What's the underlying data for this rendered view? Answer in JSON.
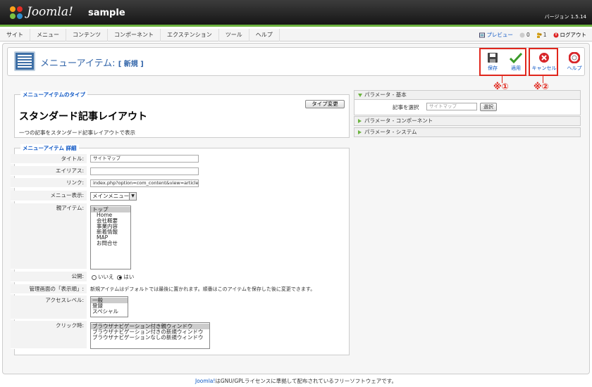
{
  "header": {
    "logo_text": "Joomla!",
    "site_name": "sample",
    "version": "バージョン 1.5.14"
  },
  "menubar": {
    "items": [
      "サイト",
      "メニュー",
      "コンテンツ",
      "コンポーネント",
      "エクステンション",
      "ツール",
      "ヘルプ"
    ],
    "preview": "プレビュー",
    "messages_count": "0",
    "users_count": "1",
    "logout": "ログアウト"
  },
  "toolbar": {
    "title": "メニューアイテム:",
    "title_sub": "[ 新規 ]",
    "save": "保存",
    "apply": "適用",
    "cancel": "キャンセル",
    "help": "ヘルプ"
  },
  "annotations": {
    "one": "※①",
    "two": "※②"
  },
  "menu_type": {
    "legend": "メニューアイテムのタイプ",
    "name": "スタンダード記事レイアウト",
    "description": "一つの記事をスタンダード記事レイアウトで表示",
    "change_button": "タイプ変更"
  },
  "details": {
    "legend": "メニューアイテム 詳細",
    "title_label": "タイトル:",
    "title_value": "サイトマップ",
    "alias_label": "エイリアス:",
    "alias_value": "",
    "link_label": "リンク:",
    "link_value": "index.php?option=com_content&view=article",
    "menu_label": "メニュー表示:",
    "menu_value": "メインメニュー",
    "parent_label": "親アイテム:",
    "parent_items": [
      "トップ",
      "Home",
      "会社概要",
      "事業内容",
      "新着情報",
      "MAP",
      "お問合せ"
    ],
    "published_label": "公開:",
    "published_no": "いいえ",
    "published_yes": "はい",
    "order_label": "管理画面の「表示順」:",
    "order_text": "新規アイテムはデフォルトでは最後に置かれます。順番はこのアイテムを保存した後に変更できます。",
    "access_label": "アクセスレベル:",
    "access_items": [
      "一般",
      "登録",
      "スペシャル"
    ],
    "click_label": "クリック時:",
    "click_items": [
      "ブラウザナビゲーション付き親ウィンドウ",
      "ブラウザナビゲーション付きの新規ウィンドウ",
      "ブラウザナビゲーションなしの新規ウィンドウ"
    ]
  },
  "params": {
    "basic": "パラメータ - 基本",
    "article_label": "記事を選択",
    "article_value": "サイトマップ",
    "select_button": "選択",
    "component": "パラメータ - コンポーネント",
    "system": "パラメータ - システム"
  },
  "footer": {
    "link": "Joomla!",
    "text": "はGNU/GPLライセンスに準拠して配布されているフリーソフトウェアです。"
  },
  "colors": {
    "accent_green": "#6cb33f",
    "link_blue": "#0b55c4",
    "callout_red": "#e0261c"
  }
}
